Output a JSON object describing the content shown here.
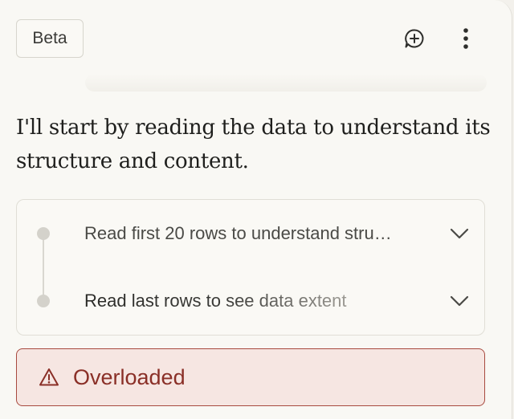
{
  "header": {
    "badge_label": "Beta",
    "icons": {
      "new_chat": "message-plus-icon",
      "more": "more-vertical-icon"
    }
  },
  "message": {
    "text": "I'll start by reading the data to understand its structure and content."
  },
  "steps": [
    {
      "label": "Read first 20 rows to understand stru…",
      "state": "completed"
    },
    {
      "label": "Read last rows to see data extent",
      "state": "in-progress"
    }
  ],
  "error": {
    "text": "Overloaded",
    "icon": "warning-icon"
  },
  "colors": {
    "background": "#f9f8f4",
    "error_background": "#f6e6e2",
    "error_border": "#a84a3f",
    "error_text": "#8a2f27"
  }
}
